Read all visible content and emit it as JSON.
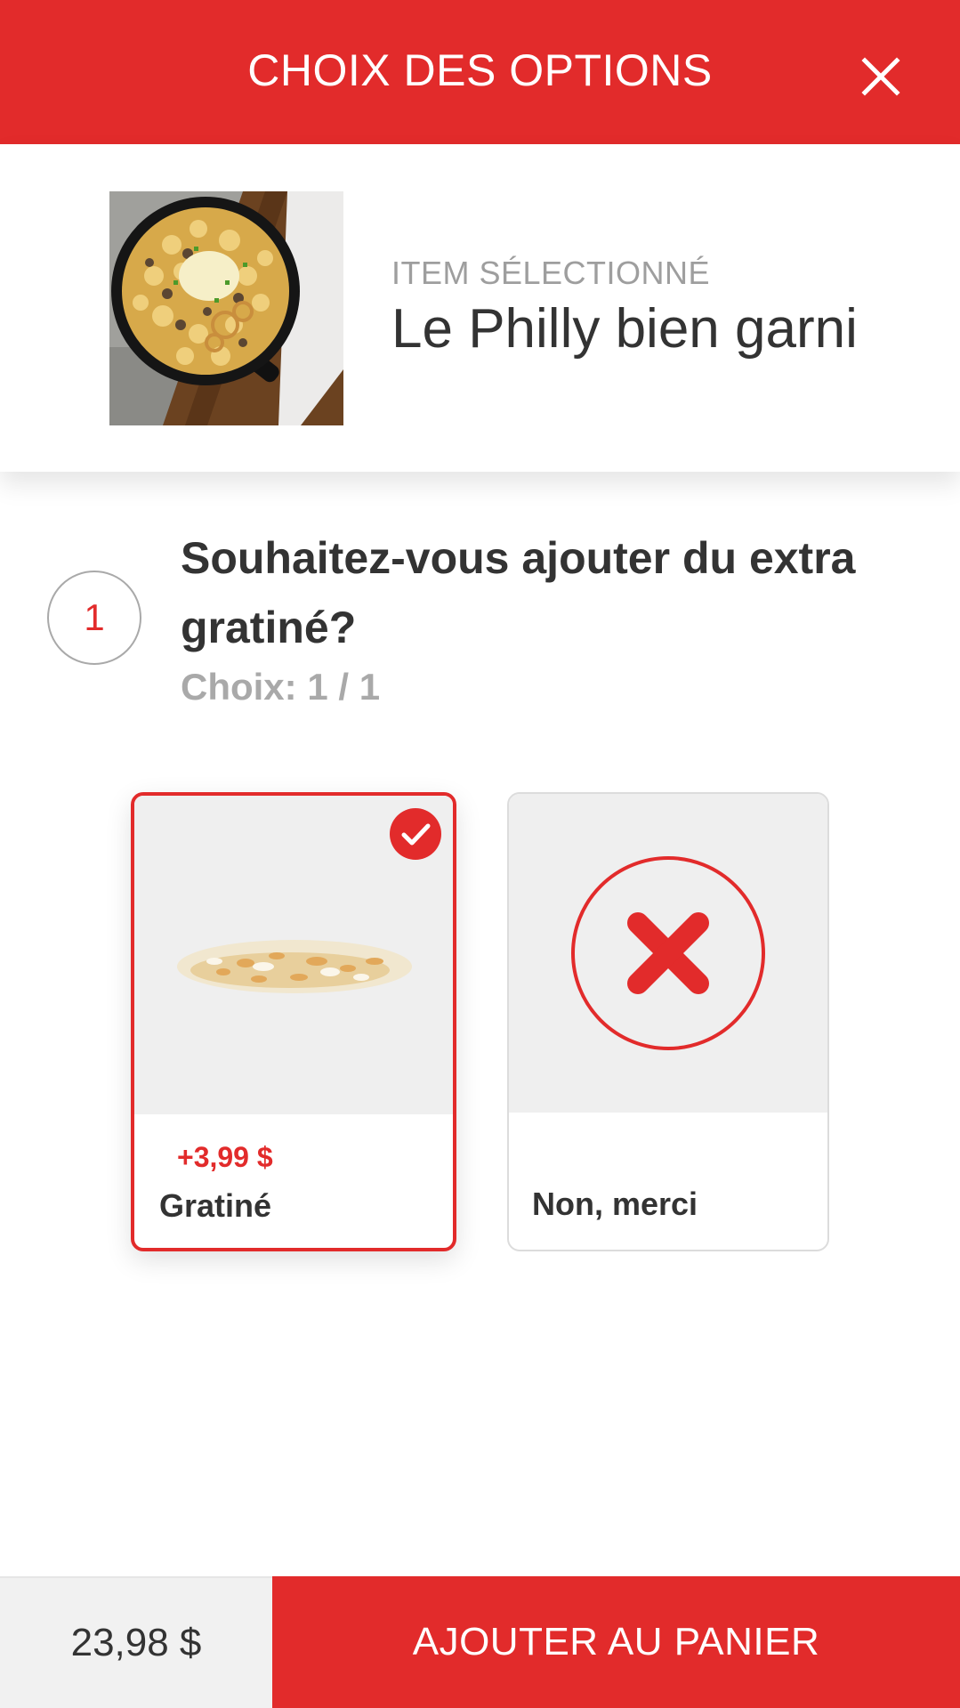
{
  "header": {
    "title": "CHOIX DES OPTIONS",
    "close_icon": "close-icon"
  },
  "selected_item": {
    "label": "ITEM SÉLECTIONNÉ",
    "name": "Le Philly bien garni",
    "image": "mac-and-cheese-skillet-photo"
  },
  "question": {
    "step": "1",
    "text": "Souhaitez-vous ajouter du extra gratiné?",
    "choice_count": "Choix: 1 / 1"
  },
  "options": [
    {
      "price": "+3,99 $",
      "label": "Gratiné",
      "selected": true,
      "image": "grated-cheese-photo",
      "badge_icon": "checkmark-icon"
    },
    {
      "price": "",
      "label": "Non, merci",
      "selected": false,
      "image": "no-option-x-icon"
    }
  ],
  "footer": {
    "total": "23,98 $",
    "add_button_label": "AJOUTER AU PANIER"
  },
  "colors": {
    "brand_red": "#e22b2b",
    "text_dark": "#333333",
    "text_muted": "#9e9e9e",
    "media_bg": "#efefef"
  }
}
